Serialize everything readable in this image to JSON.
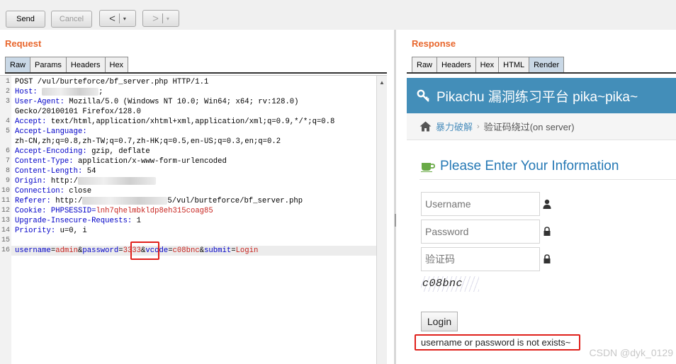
{
  "toolbar": {
    "send": "Send",
    "cancel": "Cancel",
    "back": "<",
    "forward": ">",
    "caret": "▾"
  },
  "request": {
    "title": "Request",
    "tabs": [
      "Raw",
      "Params",
      "Headers",
      "Hex"
    ],
    "lines": [
      {
        "n": "1",
        "key": "POST /vul/burteforce/bf_server.php HTTP/1.1",
        "val": ""
      },
      {
        "n": "2",
        "key": "Host:",
        "val": ";"
      },
      {
        "n": "3",
        "key": "User-Agent:",
        "val": " Mozilla/5.0 (Windows NT 10.0; Win64; x64; rv:128.0)"
      },
      {
        "n": "",
        "key": "",
        "val": "Gecko/20100101 Firefox/128.0"
      },
      {
        "n": "4",
        "key": "Accept:",
        "val": " text/html,application/xhtml+xml,application/xml;q=0.9,*/*;q=0.8"
      },
      {
        "n": "5",
        "key": "Accept-Language:",
        "val": ""
      },
      {
        "n": "",
        "key": "",
        "val": "zh-CN,zh;q=0.8,zh-TW;q=0.7,zh-HK;q=0.5,en-US;q=0.3,en;q=0.2"
      },
      {
        "n": "6",
        "key": "Accept-Encoding:",
        "val": " gzip, deflate"
      },
      {
        "n": "7",
        "key": "Content-Type:",
        "val": " application/x-www-form-urlencoded"
      },
      {
        "n": "8",
        "key": "Content-Length:",
        "val": " 54"
      },
      {
        "n": "9",
        "key": "Origin:",
        "val": " http:/"
      },
      {
        "n": "10",
        "key": "Connection:",
        "val": " close"
      },
      {
        "n": "11",
        "key": "Referer:",
        "val": " http:/",
        "tail": "5/vul/burteforce/bf_server.php"
      },
      {
        "n": "12",
        "key": "Cookie:",
        "val": " PHPSESSID=",
        "tail": "lnh7qhelmbkldp8eh315coag85"
      },
      {
        "n": "13",
        "key": "Upgrade-Insecure-Requests:",
        "val": " 1"
      },
      {
        "n": "14",
        "key": "Priority:",
        "val": " u=0, i"
      },
      {
        "n": "15",
        "key": "",
        "val": ""
      }
    ],
    "body": {
      "n": "16",
      "k1": "username",
      "eq1": "=",
      "v1": "admin",
      "amp1": "&",
      "k2": "password",
      "eq2": "=",
      "v2": "3333",
      "amp2": "&",
      "k3": "vcode",
      "eq3": "=",
      "v3": "c08bnc",
      "amp3": "&",
      "k4": "submit",
      "eq4": "=",
      "v4": "Login"
    }
  },
  "response": {
    "title": "Response",
    "tabs": [
      "Raw",
      "Headers",
      "Hex",
      "HTML",
      "Render"
    ],
    "render": {
      "brand": "Pikachu 漏洞练习平台 pika~pika~",
      "breadcrumb_link": "暴力破解",
      "breadcrumb_sep": "›",
      "breadcrumb_current": "验证码绕过(on server)",
      "section_title": "Please Enter Your Information",
      "username_placeholder": "Username",
      "password_placeholder": "Password",
      "vcode_placeholder": "验证码",
      "captcha": "c08bnc",
      "login": "Login",
      "result": "username or password is not exists~"
    }
  },
  "watermark": "CSDN @dyk_0129",
  "colors": {
    "accent": "#e8662c",
    "header_bg": "#438eb9",
    "highlight": "#e0201b",
    "key": "#0000c8"
  }
}
